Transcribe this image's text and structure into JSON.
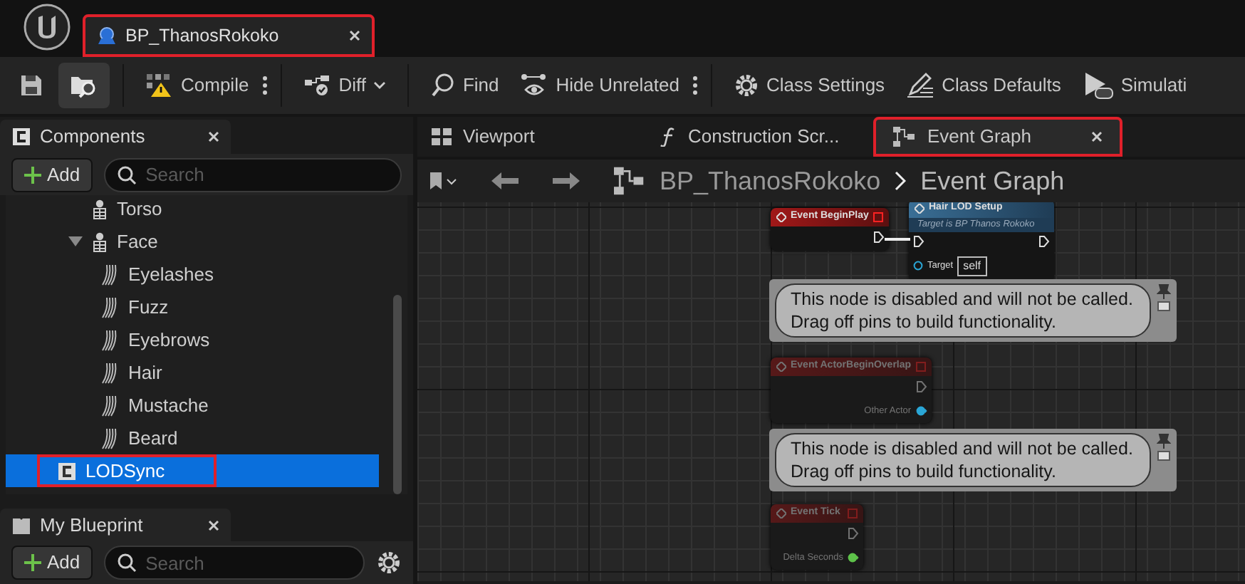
{
  "document_tab": {
    "title": "BP_ThanosRokoko",
    "highlighted": true
  },
  "toolbar": [
    {
      "kind": "icon",
      "selected": false
    },
    {
      "kind": "icon",
      "selected": true
    },
    {
      "kind": "button",
      "label": "Compile",
      "more": true
    },
    {
      "kind": "button",
      "label": "Diff",
      "dropdown": true
    },
    {
      "kind": "button",
      "label": "Find"
    },
    {
      "kind": "button",
      "label": "Hide Unrelated",
      "more": true
    },
    {
      "kind": "button",
      "label": "Class Settings"
    },
    {
      "kind": "button",
      "label": "Class Defaults"
    },
    {
      "kind": "button",
      "label": "Simulati"
    }
  ],
  "components_panel": {
    "title": "Components",
    "add_label": "Add",
    "search_placeholder": "Search",
    "tree": [
      {
        "kind": "skeleton",
        "label": "Torso",
        "selected": false
      },
      {
        "kind": "skeleton",
        "label": "Face",
        "selected": false,
        "expanded": true,
        "children": [
          {
            "kind": "groom",
            "label": "Eyelashes",
            "selected": false
          },
          {
            "kind": "groom",
            "label": "Fuzz",
            "selected": false
          },
          {
            "kind": "groom",
            "label": "Eyebrows",
            "selected": false
          },
          {
            "kind": "groom",
            "label": "Hair",
            "selected": false
          },
          {
            "kind": "groom",
            "label": "Mustache",
            "selected": false
          },
          {
            "kind": "groom",
            "label": "Beard",
            "selected": false
          }
        ]
      },
      {
        "kind": "component",
        "label": "LODSync",
        "selected": true,
        "highlighted": true
      }
    ]
  },
  "my_blueprint_panel": {
    "title": "My Blueprint",
    "add_label": "Add",
    "search_placeholder": "Search"
  },
  "graph_tabs": [
    {
      "label": "Viewport",
      "selected": false,
      "highlighted": false
    },
    {
      "label": "Construction Scr...",
      "selected": false,
      "highlighted": false
    },
    {
      "label": "Event Graph",
      "selected": true,
      "highlighted": true,
      "closable": true
    }
  ],
  "breadcrumb": [
    "BP_ThanosRokoko",
    "Event Graph"
  ],
  "graph_nodes": [
    {
      "kind": "event",
      "title": "Event BeginPlay",
      "disabled": false
    },
    {
      "kind": "function",
      "title": "Hair LOD Setup",
      "subtitle": "Target is BP Thanos Rokoko",
      "disabled": false,
      "pins": [
        {
          "label": "Target",
          "value": "self"
        }
      ]
    },
    {
      "kind": "comment",
      "text": "This node is disabled and will not be called.\nDrag off pins to build functionality."
    },
    {
      "kind": "event",
      "title": "Event ActorBeginOverlap",
      "disabled": true,
      "pins": [
        {
          "label": "Other Actor",
          "color": "#2aa6d6"
        }
      ]
    },
    {
      "kind": "comment",
      "text": "This node is disabled and will not be called.\nDrag off pins to build functionality."
    },
    {
      "kind": "event",
      "title": "Event Tick",
      "disabled": true,
      "pins": [
        {
          "label": "Delta Seconds",
          "color": "#5ec24a"
        }
      ]
    }
  ]
}
